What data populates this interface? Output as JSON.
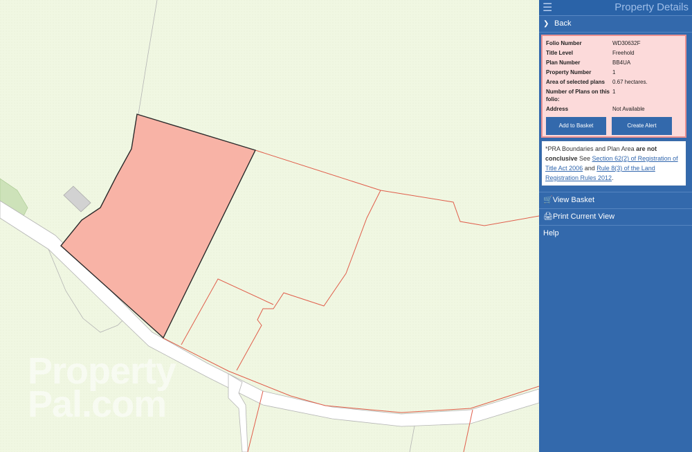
{
  "panel": {
    "title": "Property Details",
    "back_label": "Back",
    "fields": [
      {
        "label": "Folio Number",
        "value": "WD30632F"
      },
      {
        "label": "Title Level",
        "value": "Freehold"
      },
      {
        "label": "Plan Number",
        "value": "BB4UA"
      },
      {
        "label": "Property Number",
        "value": "1"
      },
      {
        "label": "Area of selected plans",
        "value": "0.67 hectares."
      },
      {
        "label": "Number of Plans on this folio:",
        "value": "1"
      },
      {
        "label": "Address",
        "value": "Not Available"
      }
    ],
    "add_basket_label": "Add to Basket",
    "create_alert_label": "Create Alert",
    "notice": {
      "prefix": "*PRA Boundaries and Plan Area ",
      "bold": "are not conclusive",
      "see": " See ",
      "link1": "Section 62(2) of Registration of Title Act 2006",
      "and": " and ",
      "link2": "Rule 8(3) of the Land Registration Rules 2012"
    },
    "menu": {
      "view_basket": "View Basket",
      "print_view": "Print Current View",
      "help": "Help"
    }
  },
  "map": {
    "watermark_line1": "Property",
    "watermark_line2": "Pal.com"
  },
  "colors": {
    "selected_parcel": "#f8b3a6",
    "boundary": "#e05d4a",
    "road": "#ffffff",
    "map_bg": "#f0f7e2",
    "panel_bg": "#3369ac"
  }
}
